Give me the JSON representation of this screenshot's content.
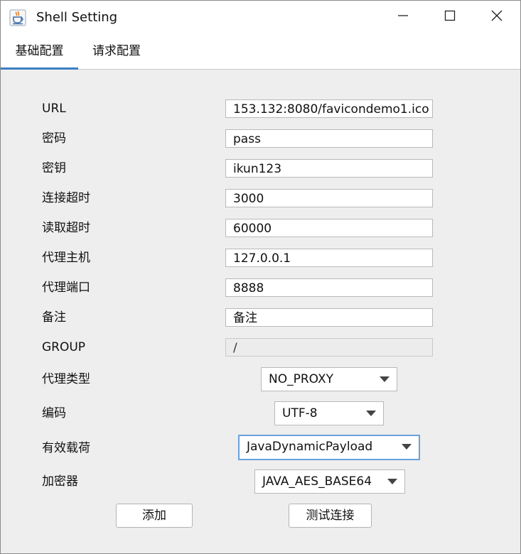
{
  "window": {
    "title": "Shell Setting"
  },
  "tabs": [
    {
      "label": "基础配置",
      "active": true
    },
    {
      "label": "请求配置",
      "active": false
    }
  ],
  "form": {
    "url": {
      "label": "URL",
      "value": "153.132:8080/favicondemo1.ico"
    },
    "password": {
      "label": "密码",
      "value": "pass"
    },
    "secret_key": {
      "label": "密钥",
      "value": "ikun123"
    },
    "conn_timeout": {
      "label": "连接超时",
      "value": "3000"
    },
    "read_timeout": {
      "label": "读取超时",
      "value": "60000"
    },
    "proxy_host": {
      "label": "代理主机",
      "value": "127.0.0.1"
    },
    "proxy_port": {
      "label": "代理端口",
      "value": "8888"
    },
    "remark": {
      "label": "备注",
      "value": "备注"
    },
    "group": {
      "label": "GROUP",
      "value": "/"
    },
    "proxy_type": {
      "label": "代理类型",
      "selected": "NO_PROXY"
    },
    "encoding": {
      "label": "编码",
      "selected": "UTF-8"
    },
    "payload": {
      "label": "有效载荷",
      "selected": "JavaDynamicPayload"
    },
    "cryption": {
      "label": "加密器",
      "selected": "JAVA_AES_BASE64"
    }
  },
  "buttons": {
    "add": "添加",
    "test": "测试连接"
  },
  "colors": {
    "accent": "#3c7fc4",
    "focus_border": "#6aa1dd"
  },
  "icons": {
    "app": "java-coffee-cup-icon",
    "minimize": "minimize-icon",
    "maximize": "maximize-icon",
    "close": "close-icon"
  }
}
